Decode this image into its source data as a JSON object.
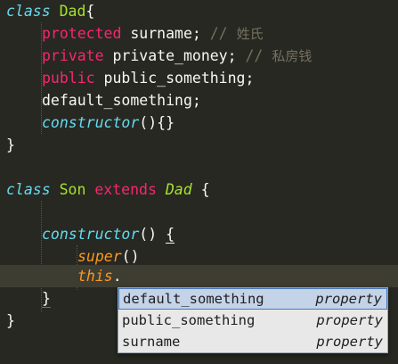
{
  "code": {
    "dad_class_keyword": "class",
    "dad_class_name": "Dad",
    "dad_open_brace": "{",
    "protected_keyword": "protected",
    "surname_decl": " surname;",
    "comment_slashes_1": " // ",
    "comment_surname": "姓氏",
    "private_keyword": "private",
    "private_money_decl": " private_money;",
    "comment_slashes_2": " // ",
    "comment_private_money": "私房钱",
    "public_keyword": "public",
    "public_something_decl": " public_something;",
    "default_something_decl": "default_something;",
    "dad_constructor_keyword": "constructor",
    "dad_constructor_tail": "(){}",
    "dad_close_brace": "}",
    "son_class_keyword": "class",
    "son_class_name": "Son",
    "extends_keyword": "extends",
    "son_parent_name": "Dad",
    "son_open_brace": "{",
    "son_constructor_keyword": "constructor",
    "son_constructor_paren": "() ",
    "son_constructor_brace": "{",
    "super_keyword": "super",
    "super_call": "()",
    "this_keyword": "this",
    "this_dot": ".",
    "son_constructor_close": "}",
    "son_close_brace": "}"
  },
  "autocomplete": {
    "items": [
      {
        "label": "default_something",
        "kind": "property",
        "selected": true
      },
      {
        "label": "public_something",
        "kind": "property",
        "selected": false
      },
      {
        "label": "surname",
        "kind": "property",
        "selected": false
      }
    ]
  },
  "theme": {
    "background": "#272822",
    "keyword_blue": "#66d9ef",
    "keyword_pink": "#f92672",
    "class_green": "#a6e22e",
    "super_orange": "#fd971f",
    "comment_gray": "#75715e",
    "popup_selected": "#c4d3e8"
  }
}
